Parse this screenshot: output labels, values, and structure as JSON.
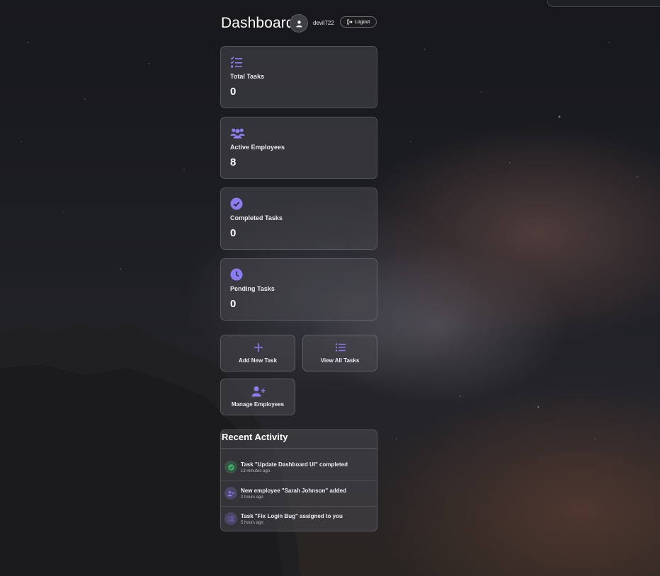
{
  "header": {
    "title": "Dashboard",
    "username": "devil722",
    "logout_label": "Logout"
  },
  "stats": [
    {
      "icon": "task-list-icon",
      "label": "Total Tasks",
      "value": "0"
    },
    {
      "icon": "users-icon",
      "label": "Active Employees",
      "value": "8"
    },
    {
      "icon": "check-circle-icon",
      "label": "Completed Tasks",
      "value": "0"
    },
    {
      "icon": "clock-icon",
      "label": "Pending Tasks",
      "value": "0"
    }
  ],
  "actions": [
    {
      "icon": "plus-icon",
      "label": "Add New Task"
    },
    {
      "icon": "list-icon",
      "label": "View All Tasks"
    },
    {
      "icon": "user-plus-icon",
      "label": "Manage Employees"
    }
  ],
  "activity": {
    "title": "Recent Activity",
    "items": [
      {
        "icon": "check-circle-icon",
        "text": "Task \"Update Dashboard UI\" completed",
        "time": "13 minutes ago"
      },
      {
        "icon": "user-plus-icon",
        "text": "New employee \"Sarah Johnson\" added",
        "time": "2 hours ago"
      },
      {
        "icon": "list-icon",
        "text": "Task \"Fix Login Bug\" assigned to you",
        "time": "5 hours ago"
      }
    ]
  },
  "colors": {
    "accent": "#8b7cf0",
    "success": "#3fb36b",
    "card_bg": "#48484e"
  }
}
